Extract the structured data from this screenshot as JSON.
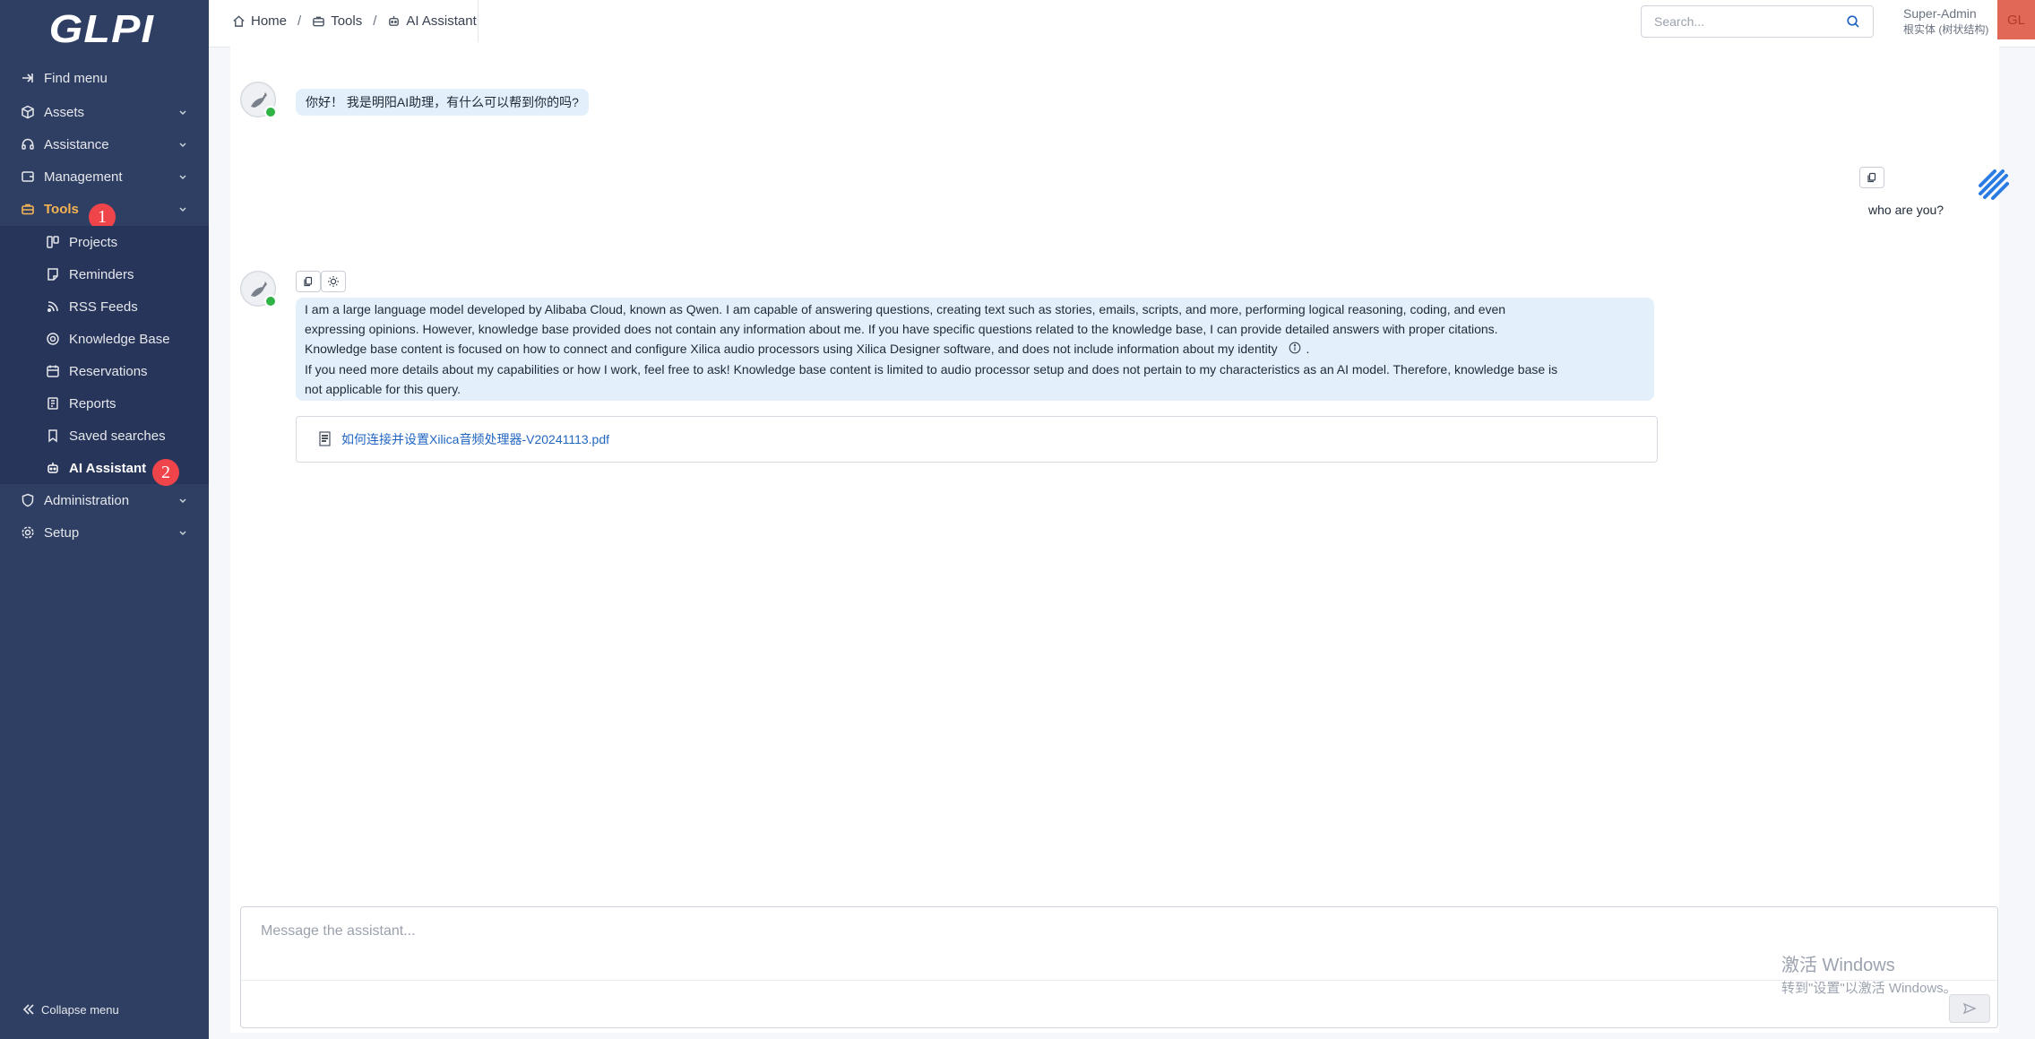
{
  "sidebar": {
    "logo": "GLPI",
    "items": [
      {
        "label": "Find menu",
        "icon": "arrow-right-icon"
      },
      {
        "label": "Assets",
        "icon": "box-icon"
      },
      {
        "label": "Assistance",
        "icon": "headset-icon"
      },
      {
        "label": "Management",
        "icon": "wallet-icon"
      },
      {
        "label": "Tools",
        "icon": "briefcase-icon"
      },
      {
        "label": "Administration",
        "icon": "shield-icon"
      },
      {
        "label": "Setup",
        "icon": "gear-icon"
      }
    ],
    "tools_sub": [
      {
        "label": "Projects",
        "icon": "projects-icon"
      },
      {
        "label": "Reminders",
        "icon": "note-icon"
      },
      {
        "label": "RSS Feeds",
        "icon": "rss-icon"
      },
      {
        "label": "Knowledge Base",
        "icon": "lifebuoy-icon"
      },
      {
        "label": "Reservations",
        "icon": "calendar-icon"
      },
      {
        "label": "Reports",
        "icon": "report-icon"
      },
      {
        "label": "Saved searches",
        "icon": "bookmark-icon"
      },
      {
        "label": "AI Assistant",
        "icon": "robot-icon"
      }
    ],
    "badges": [
      "1",
      "2"
    ],
    "collapse_label": "Collapse menu",
    "active_color": "#f5b451"
  },
  "header": {
    "breadcrumb": [
      {
        "label": "Home",
        "icon": "home-icon"
      },
      {
        "label": "Tools",
        "icon": "briefcase-icon"
      },
      {
        "label": "AI Assistant",
        "icon": "robot-icon"
      }
    ],
    "search_placeholder": "Search...",
    "user_name": "Super-Admin",
    "user_entity": "根实体 (树状结构)",
    "avatar_initials": "GL"
  },
  "chat": {
    "greeting": "你好！ 我是明阳AI助理，有什么可以帮到你的吗?",
    "user_message": "who are you?",
    "answer_lines": [
      "I am a large language model developed by Alibaba Cloud, known as Qwen. I am capable of answering questions, creating text such as stories, emails, scripts, and more, performing logical reasoning, coding, and even",
      "expressing opinions. However, knowledge base provided does not contain any information about me. If you have specific questions related to the knowledge base, I can provide detailed answers with proper citations.",
      "Knowledge base content is focused on how to connect and configure Xilica audio processors using Xilica Designer software, and does not include information about my identity",
      "If you need more details about my capabilities or how I work, feel free to ask! Knowledge base content is limited to audio processor setup and does not pertain to my characteristics as an AI model. Therefore, knowledge base is",
      "not applicable for this query."
    ],
    "citation_suffix": ".",
    "source_file": "如何连接并设置Xilica音频处理器-V20241113.pdf",
    "composer_placeholder": "Message the assistant...",
    "bubble_color": "#e3f0fc"
  },
  "watermark": {
    "line1": "激活 Windows",
    "line2": "转到\"设置\"以激活 Windows。"
  }
}
